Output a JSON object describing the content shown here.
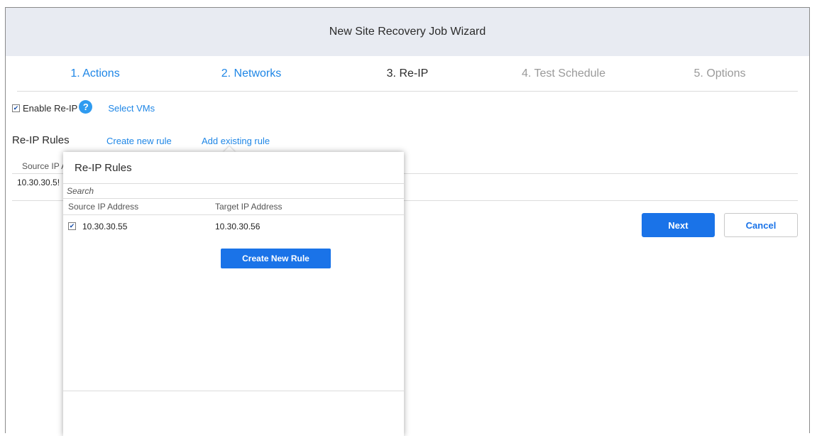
{
  "wizard": {
    "title": "New Site Recovery Job Wizard",
    "steps": [
      {
        "label": "1. Actions",
        "state": "link"
      },
      {
        "label": "2. Networks",
        "state": "link"
      },
      {
        "label": "3. Re-IP",
        "state": "active"
      },
      {
        "label": "4. Test Schedule",
        "state": "disabled"
      },
      {
        "label": "5. Options",
        "state": "disabled"
      }
    ]
  },
  "reip": {
    "enable_label": "Enable Re-IP",
    "enable_checked": true,
    "help_icon": "question-circle-icon",
    "help_glyph": "?",
    "select_vms": "Select VMs",
    "rules_title": "Re-IP Rules",
    "create_new_rule_link": "Create new rule",
    "add_existing_rule_link": "Add existing rule",
    "table": {
      "header_source_partial": "Source IP A",
      "row_source_partial": "10.30.30.5!"
    }
  },
  "buttons": {
    "next": "Next",
    "cancel": "Cancel"
  },
  "popup": {
    "title": "Re-IP Rules",
    "search_placeholder": "Search",
    "columns": [
      "Source IP Address",
      "Target IP Address"
    ],
    "rows": [
      {
        "checked": true,
        "source": "10.30.30.55",
        "target": "10.30.30.56"
      }
    ],
    "create_button": "Create New Rule"
  },
  "colors": {
    "accent": "#1a73e8",
    "link": "#1e86e6",
    "header_bg": "#e8ebf2",
    "disabled": "#9a9a9a"
  }
}
